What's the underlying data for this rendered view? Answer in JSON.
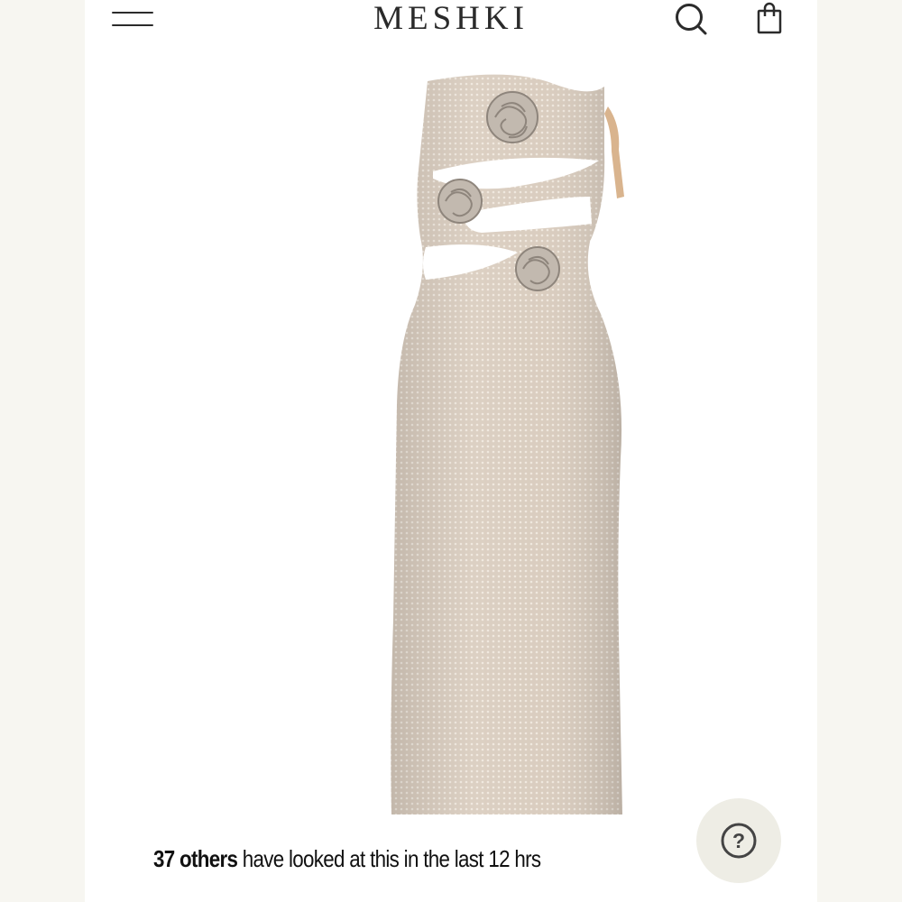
{
  "header": {
    "brand": "MESHKI",
    "menu_icon": "hamburger-menu-icon",
    "search_icon": "search-icon",
    "bag_icon": "shopping-bag-icon"
  },
  "product": {
    "image_description_icon": "product-photo"
  },
  "social_proof": {
    "count": "37 others",
    "message": " have looked at this in the last 12 hrs"
  },
  "help": {
    "icon": "question-icon",
    "label": "?"
  },
  "colors": {
    "background": "#ffffff",
    "side_margin": "#f7f6f1",
    "text": "#2a2a2a",
    "dress": "#d8cbbc",
    "help_bg": "#eeede5"
  }
}
